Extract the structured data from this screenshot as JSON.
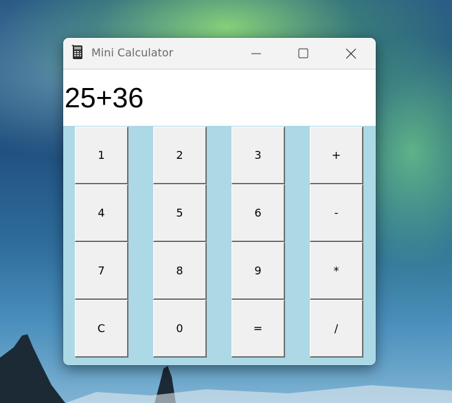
{
  "window": {
    "title": "Mini Calculator",
    "app_icon": "calculator-icon",
    "controls": [
      "minimize-icon",
      "maximize-icon",
      "close-icon"
    ]
  },
  "display": {
    "value": "25+36"
  },
  "keypad": {
    "rows": [
      [
        "1",
        "2",
        "3",
        "+"
      ],
      [
        "4",
        "5",
        "6",
        "-"
      ],
      [
        "7",
        "8",
        "9",
        "*"
      ],
      [
        "C",
        "0",
        "=",
        "/"
      ]
    ]
  },
  "colors": {
    "keypad_background": "#add8e6",
    "button_face": "#f0f0f0",
    "display_background": "#ffffff",
    "titlebar": "#f3f3f3"
  }
}
